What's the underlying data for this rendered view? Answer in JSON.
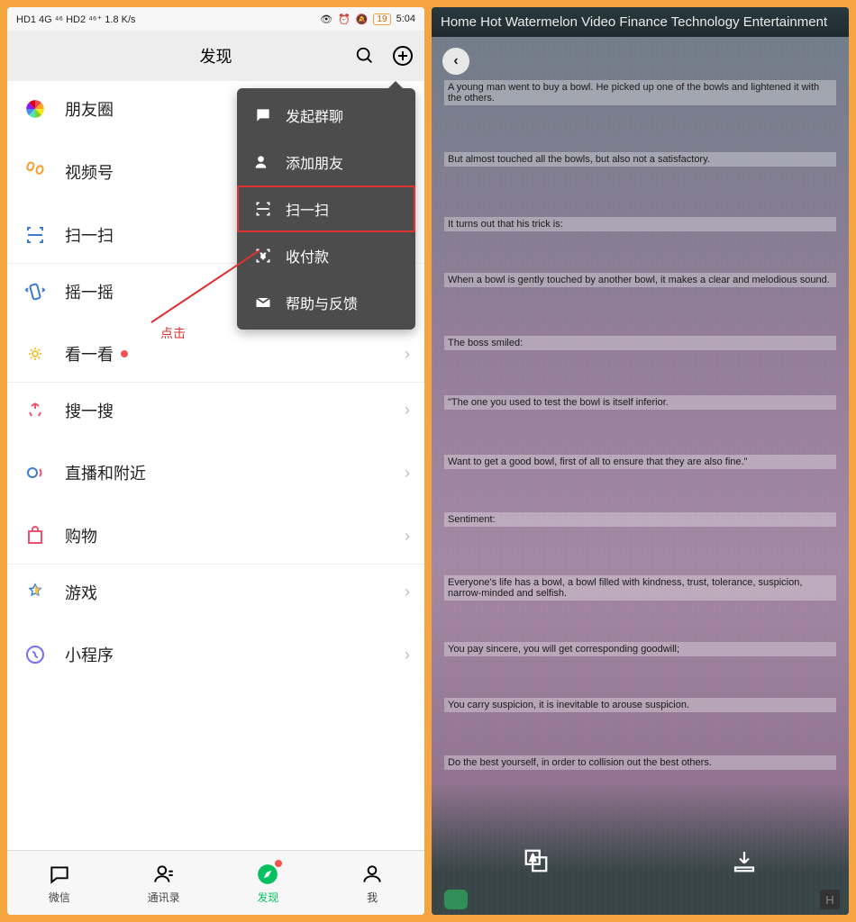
{
  "status": {
    "left": "HD1 4G ⁴⁶ HD2 ⁴⁶⁺ 1.8 K/s",
    "eye": "👁",
    "alarm": "⏰",
    "vibrate": "🔕",
    "battery": "19",
    "time": "5:04"
  },
  "header": {
    "title": "发现"
  },
  "discover": {
    "moments": "朋友圈",
    "channels": "视频号",
    "scan": "扫一扫",
    "shake": "摇一摇",
    "topstories": "看一看",
    "search": "搜一搜",
    "nearby": "直播和附近",
    "shopping": "购物",
    "games": "游戏",
    "miniprog": "小程序"
  },
  "dropdown": {
    "groupchat": "发起群聊",
    "addfriend": "添加朋友",
    "scan": "扫一扫",
    "money": "收付款",
    "feedback": "帮助与反馈"
  },
  "annotation": {
    "click": "点击"
  },
  "tabs": {
    "wechat": "微信",
    "contacts": "通讯录",
    "discover": "发现",
    "me": "我"
  },
  "scan": {
    "nav": "Home Hot Watermelon Video Finance Technology Entertainment",
    "lines": [
      "A young man went to buy a bowl. He picked up one of the bowls and lightened it with the others.",
      "But almost touched all the bowls, but also not a satisfactory.",
      "It turns out that his trick is:",
      "When a bowl is gently touched by another bowl, it makes a clear and melodious sound.",
      "The boss smiled:",
      "\"The one you used to test the bowl is itself inferior.",
      "Want to get a good bowl, first of all to ensure that they are also fine.\"",
      "Sentiment:",
      "Everyone's life has a bowl, a bowl filled with kindness, trust, tolerance, suspicion, narrow-minded and selfish.",
      "You pay sincere, you will get corresponding goodwill;",
      "You carry suspicion, it is inevitable to arouse suspicion.",
      "Do the best yourself, in order to collision out the best others."
    ],
    "h": "H"
  }
}
